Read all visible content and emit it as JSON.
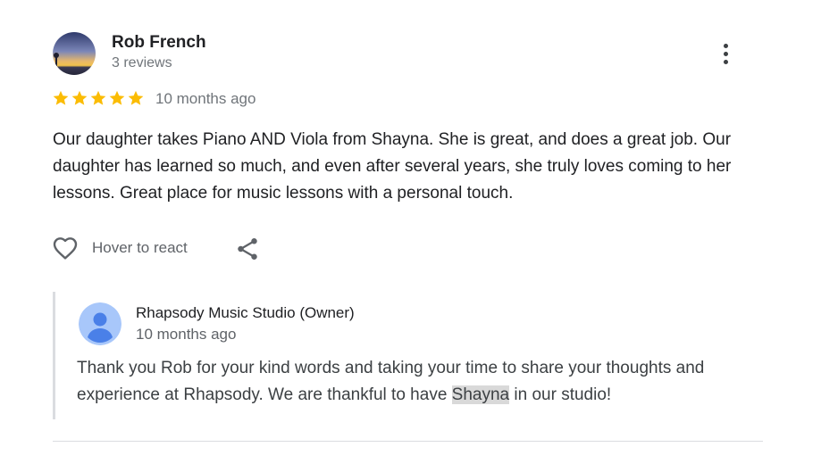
{
  "review": {
    "reviewer_name": "Rob French",
    "reviewer_reviews": "3 reviews",
    "rating": 5,
    "rating_max": 5,
    "time": "10 months ago",
    "text": "Our daughter takes Piano AND Viola from Shayna. She is great, and does a great job. Our daughter has learned so much, and even after several years, she truly loves coming to her lessons. Great place for music lessons with a personal touch.",
    "react_label": "Hover to react"
  },
  "owner_reply": {
    "name": "Rhapsody Music Studio (Owner)",
    "time": "10 months ago",
    "text_before": "Thank you Rob for your kind words and taking your time to share your thoughts and experience at Rhapsody. We are thankful to have ",
    "text_highlight": "Shayna",
    "text_after": " in our studio!"
  },
  "icons": {
    "more": "more-vert-icon",
    "heart": "heart-outline-icon",
    "share": "share-icon",
    "star": "star-filled-icon",
    "owner_avatar": "person-icon"
  },
  "colors": {
    "star": "#fbbc04",
    "owner_avatar_bg": "#a8c7fa",
    "owner_avatar_fg": "#4a80e8",
    "text_primary": "#202124",
    "text_secondary": "#70757a",
    "highlight": "#d9d9d9"
  }
}
